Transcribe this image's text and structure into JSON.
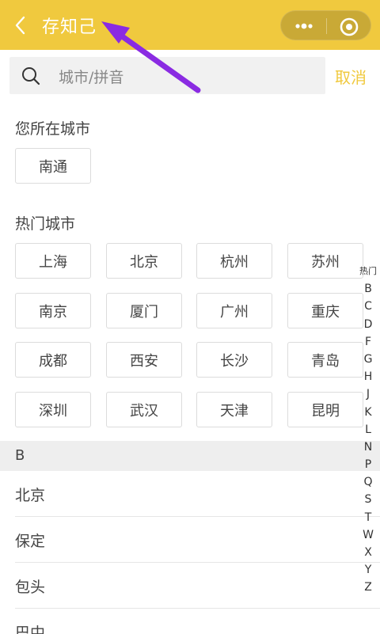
{
  "nav": {
    "title": "存知己",
    "back_icon": "chevron-left-icon",
    "menu_icon": "more-dots-icon",
    "close_icon": "target-circle-icon"
  },
  "search": {
    "placeholder": "城市/拼音",
    "cancel_label": "取消",
    "icon": "search-icon"
  },
  "current_city": {
    "heading": "您所在城市",
    "city": "南通"
  },
  "hot_cities": {
    "heading": "热门城市",
    "cities": [
      "上海",
      "北京",
      "杭州",
      "苏州",
      "南京",
      "厦门",
      "广州",
      "重庆",
      "成都",
      "西安",
      "长沙",
      "青岛",
      "深圳",
      "武汉",
      "天津",
      "昆明"
    ]
  },
  "list": {
    "group_letter": "B",
    "items": [
      "北京",
      "保定",
      "包头",
      "巴中"
    ]
  },
  "index": [
    "热门",
    "B",
    "C",
    "D",
    "F",
    "G",
    "H",
    "J",
    "K",
    "L",
    "N",
    "P",
    "Q",
    "S",
    "T",
    "W",
    "X",
    "Y",
    "Z"
  ],
  "colors": {
    "accent": "#f0c93e",
    "annotation_arrow": "#8a2be2"
  }
}
